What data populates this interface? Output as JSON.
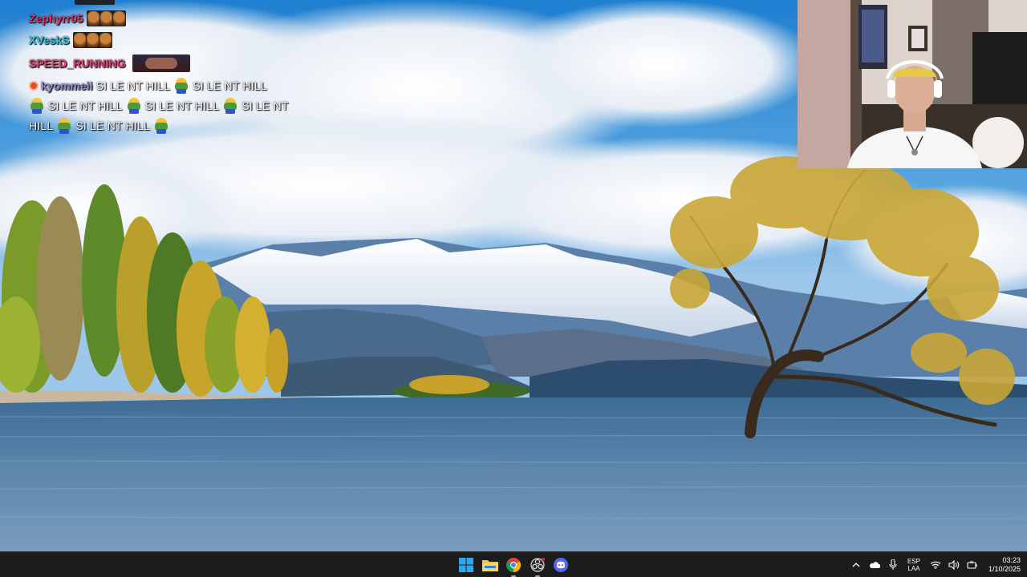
{
  "chat": {
    "messages": [
      {
        "username": "Zephyrr05",
        "color": "#e0396b",
        "emote_count": 3
      },
      {
        "username": "XVeskS",
        "color": "#2fc6e8",
        "emote_count": 3
      },
      {
        "username": "SPEED_RUNNING",
        "color": "#e0396b"
      },
      {
        "username": "kyommeii",
        "color": "#8a8ad0",
        "text": [
          "SI LE NT HILL",
          "SI LE NT HILL",
          "SI LE NT HILL",
          "SI LE NT HILL",
          "SI LE NT",
          "HILL",
          "SI LE NT HILL"
        ]
      }
    ]
  },
  "taskbar": {
    "apps": [
      {
        "name": "start",
        "icon": "windows-logo-icon"
      },
      {
        "name": "file-explorer",
        "icon": "folder-icon"
      },
      {
        "name": "chrome",
        "icon": "chrome-icon",
        "active": true
      },
      {
        "name": "obs",
        "icon": "obs-icon",
        "active": true
      },
      {
        "name": "discord",
        "icon": "discord-icon"
      }
    ],
    "tray": {
      "language_line1": "ESP",
      "language_line2": "LAA",
      "time": "03:23",
      "date": "1/10/2025"
    }
  },
  "colors": {
    "taskbar_bg": "#1c1c1c",
    "windows_blue": "#2fa7ee",
    "chrome_red": "#db4437",
    "chrome_yellow": "#f4b400",
    "chrome_green": "#0f9d58",
    "discord_blurple": "#5865f2",
    "folder_yellow": "#f4c542"
  }
}
